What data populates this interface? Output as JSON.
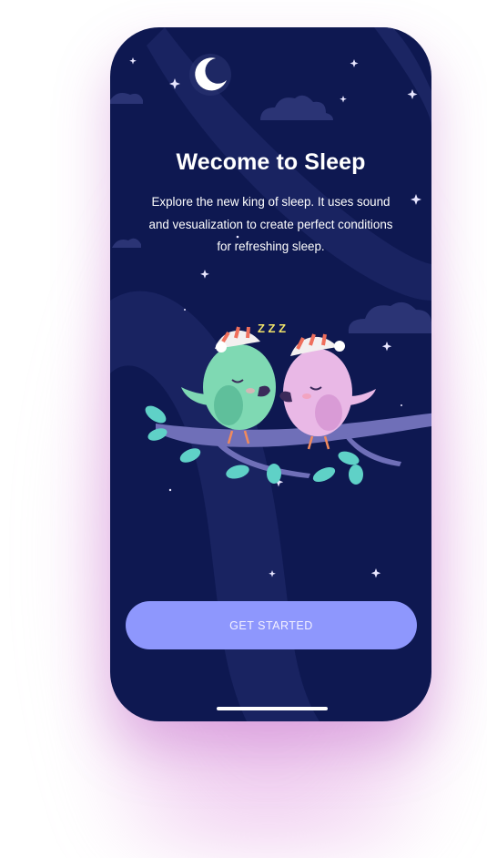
{
  "welcome": {
    "title": "Wecome to Sleep",
    "subtitle": "Explore the new king of sleep. It uses sound and vesualization to create perfect conditions for refreshing sleep.",
    "snore": "Z Z Z"
  },
  "cta": {
    "label": "GET STARTED"
  },
  "colors": {
    "background": "#0e1851",
    "accent_button": "#8e97fd",
    "glow": "#d678d6",
    "green_bird": "#7fd9b3",
    "pink_bird": "#e9b8e6",
    "branch": "#6f6fb8",
    "leaf": "#5fd1c7"
  },
  "icons": {
    "moon": "crescent-moon-icon",
    "star": "sparkle-star-icon",
    "cloud": "cloud-icon"
  }
}
